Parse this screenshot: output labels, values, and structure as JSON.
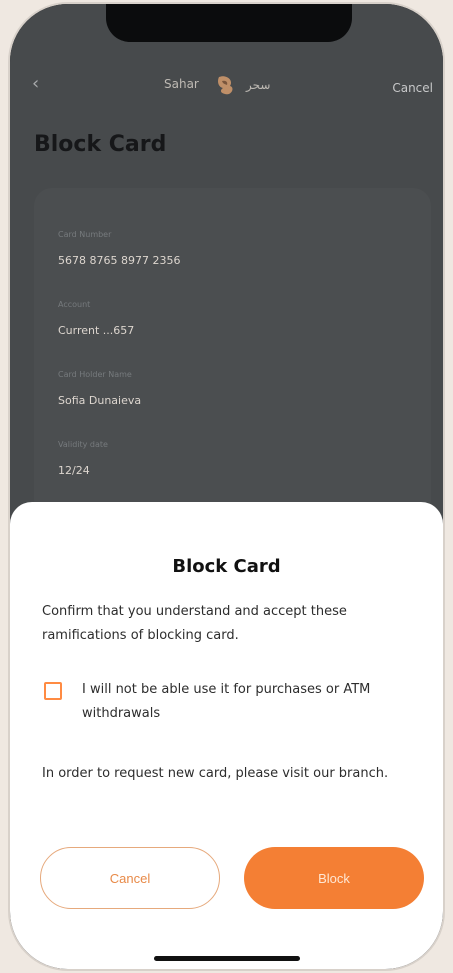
{
  "header": {
    "back_label": "‹",
    "logo_text": "Sahar",
    "logo_arabic": "سحر",
    "cancel_label": "Cancel"
  },
  "page": {
    "title": "Block Card"
  },
  "card_details": {
    "fields": [
      {
        "label": "Card Number",
        "value": "5678 8765 8977 2356"
      },
      {
        "label": "Account",
        "value": "Current ...657"
      },
      {
        "label": "Card Holder Name",
        "value": "Sofia Dunaieva"
      },
      {
        "label": "Validity date",
        "value": "12/24"
      }
    ]
  },
  "modal": {
    "title": "Block Card",
    "message": "Confirm that you understand and accept these ramifications of blocking card.",
    "checkbox_label": "I will not be able use it for purchases or ATM withdrawals",
    "note": "In order to request new card, please visit our branch.",
    "cancel_button": "Cancel",
    "block_button": "Block"
  },
  "colors": {
    "accent": "#f47f34",
    "accent_light": "#e6a97c",
    "sheet_bg": "#ffffff",
    "screen_bg": "#474a4c"
  },
  "icons": {
    "back": "chevron-left-icon",
    "logo": "sahar-logo-icon"
  }
}
